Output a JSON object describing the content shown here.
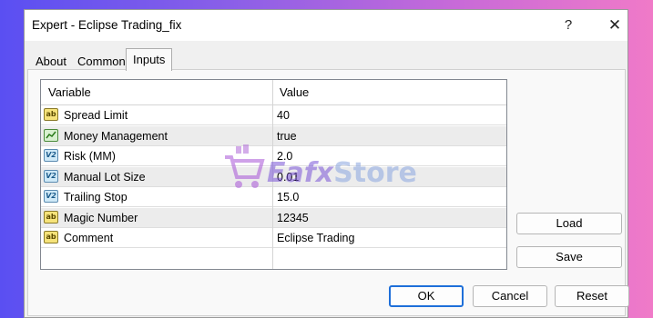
{
  "window": {
    "title": "Expert - Eclipse Trading_fix",
    "help_glyph": "?",
    "close_glyph": "✕"
  },
  "tabs": [
    {
      "label": "About"
    },
    {
      "label": "Common"
    },
    {
      "label": "Inputs",
      "active": true
    }
  ],
  "grid": {
    "headers": {
      "variable": "Variable",
      "value": "Value"
    },
    "rows": [
      {
        "icon": "ab-text-icon",
        "icon_text": "ab",
        "name": "Spread Limit",
        "value": "40"
      },
      {
        "icon": "boolean-icon",
        "icon_text": "",
        "name": "Money Management",
        "value": "true"
      },
      {
        "icon": "double-value-icon",
        "icon_text": "V2",
        "name": "Risk (MM)",
        "value": "2.0"
      },
      {
        "icon": "double-value-icon",
        "icon_text": "V2",
        "name": "Manual Lot Size",
        "value": "0.01"
      },
      {
        "icon": "double-value-icon",
        "icon_text": "V2",
        "name": "Trailing Stop",
        "value": "15.0"
      },
      {
        "icon": "ab-text-icon",
        "icon_text": "ab",
        "name": "Magic Number",
        "value": "12345"
      },
      {
        "icon": "ab-text-icon",
        "icon_text": "ab",
        "name": "Comment",
        "value": "Eclipse Trading"
      }
    ]
  },
  "side_buttons": {
    "load": "Load",
    "save": "Save"
  },
  "footer_buttons": {
    "ok": "OK",
    "cancel": "Cancel",
    "reset": "Reset"
  },
  "watermark": {
    "brand": "Eafx",
    "suffix": "Store"
  }
}
